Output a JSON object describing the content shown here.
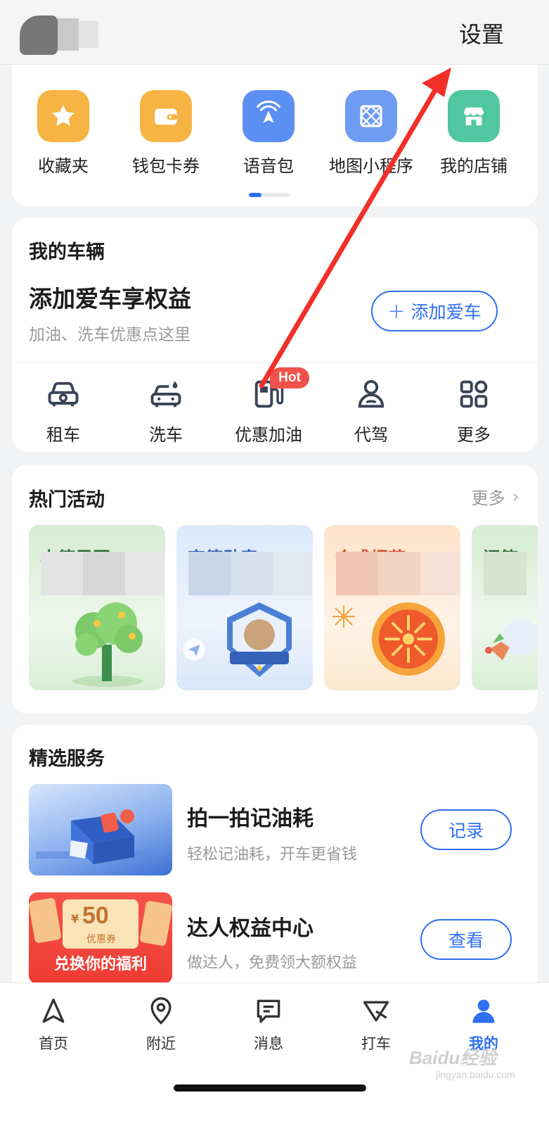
{
  "header": {
    "settings_label": "设置"
  },
  "tools": {
    "items": [
      {
        "label": "收藏夹",
        "icon": "star-icon",
        "color": "#f7b444"
      },
      {
        "label": "钱包卡券",
        "icon": "wallet-icon",
        "color": "#f7b444"
      },
      {
        "label": "语音包",
        "icon": "voice-pack-icon",
        "color": "#5b8ff2"
      },
      {
        "label": "地图小程序",
        "icon": "mini-program-icon",
        "color": "#6f9cf3"
      },
      {
        "label": "我的店铺",
        "icon": "store-icon",
        "color": "#4fc7a0"
      }
    ]
  },
  "vehicle": {
    "title": "我的车辆",
    "headline": "添加爱车享权益",
    "subtitle": "加油、洗车优惠点这里",
    "add_button": "添加爱车",
    "services": [
      {
        "label": "租车",
        "icon": "rental-car-icon"
      },
      {
        "label": "洗车",
        "icon": "car-wash-icon"
      },
      {
        "label": "优惠加油",
        "icon": "fuel-pump-icon"
      },
      {
        "label": "代驾",
        "icon": "chauffeur-icon"
      },
      {
        "label": "更多",
        "icon": "grid-more-icon"
      }
    ],
    "hot_badge": "Hot"
  },
  "activities": {
    "title": "热门活动",
    "more_label": "更多",
    "tiles": [
      {
        "title": "小德果园",
        "title_color": "#2f6b3a"
      },
      {
        "title": "高德勋章",
        "title_color": "#2f5fb5"
      },
      {
        "title": "合成烟花",
        "title_color": "#d34a2a"
      },
      {
        "title": "问答",
        "title_color": "#2f6b3a"
      }
    ]
  },
  "featured": {
    "title": "精选服务",
    "items": [
      {
        "title": "拍一拍记油耗",
        "subtitle": "轻松记油耗，开车更省钱",
        "button": "记录"
      },
      {
        "title": "达人权益中心",
        "subtitle": "做达人，免费领大额权益",
        "button": "查看",
        "coupon_amount": "50",
        "coupon_label": "优惠券",
        "coupon_currency": "¥",
        "promo_text": "兑换你的福利"
      }
    ]
  },
  "bottom_nav": {
    "items": [
      {
        "label": "首页",
        "icon": "navigation-arrow-icon"
      },
      {
        "label": "附近",
        "icon": "location-pin-icon"
      },
      {
        "label": "消息",
        "icon": "message-icon"
      },
      {
        "label": "打车",
        "icon": "taxi-icon"
      },
      {
        "label": "我的",
        "icon": "profile-icon",
        "active": true
      }
    ]
  },
  "watermark": {
    "text": "Baidu经验",
    "sub": "jingyan.baidu.com"
  },
  "colors": {
    "accent": "#2e6ff2",
    "annotation": "#f2302a"
  }
}
